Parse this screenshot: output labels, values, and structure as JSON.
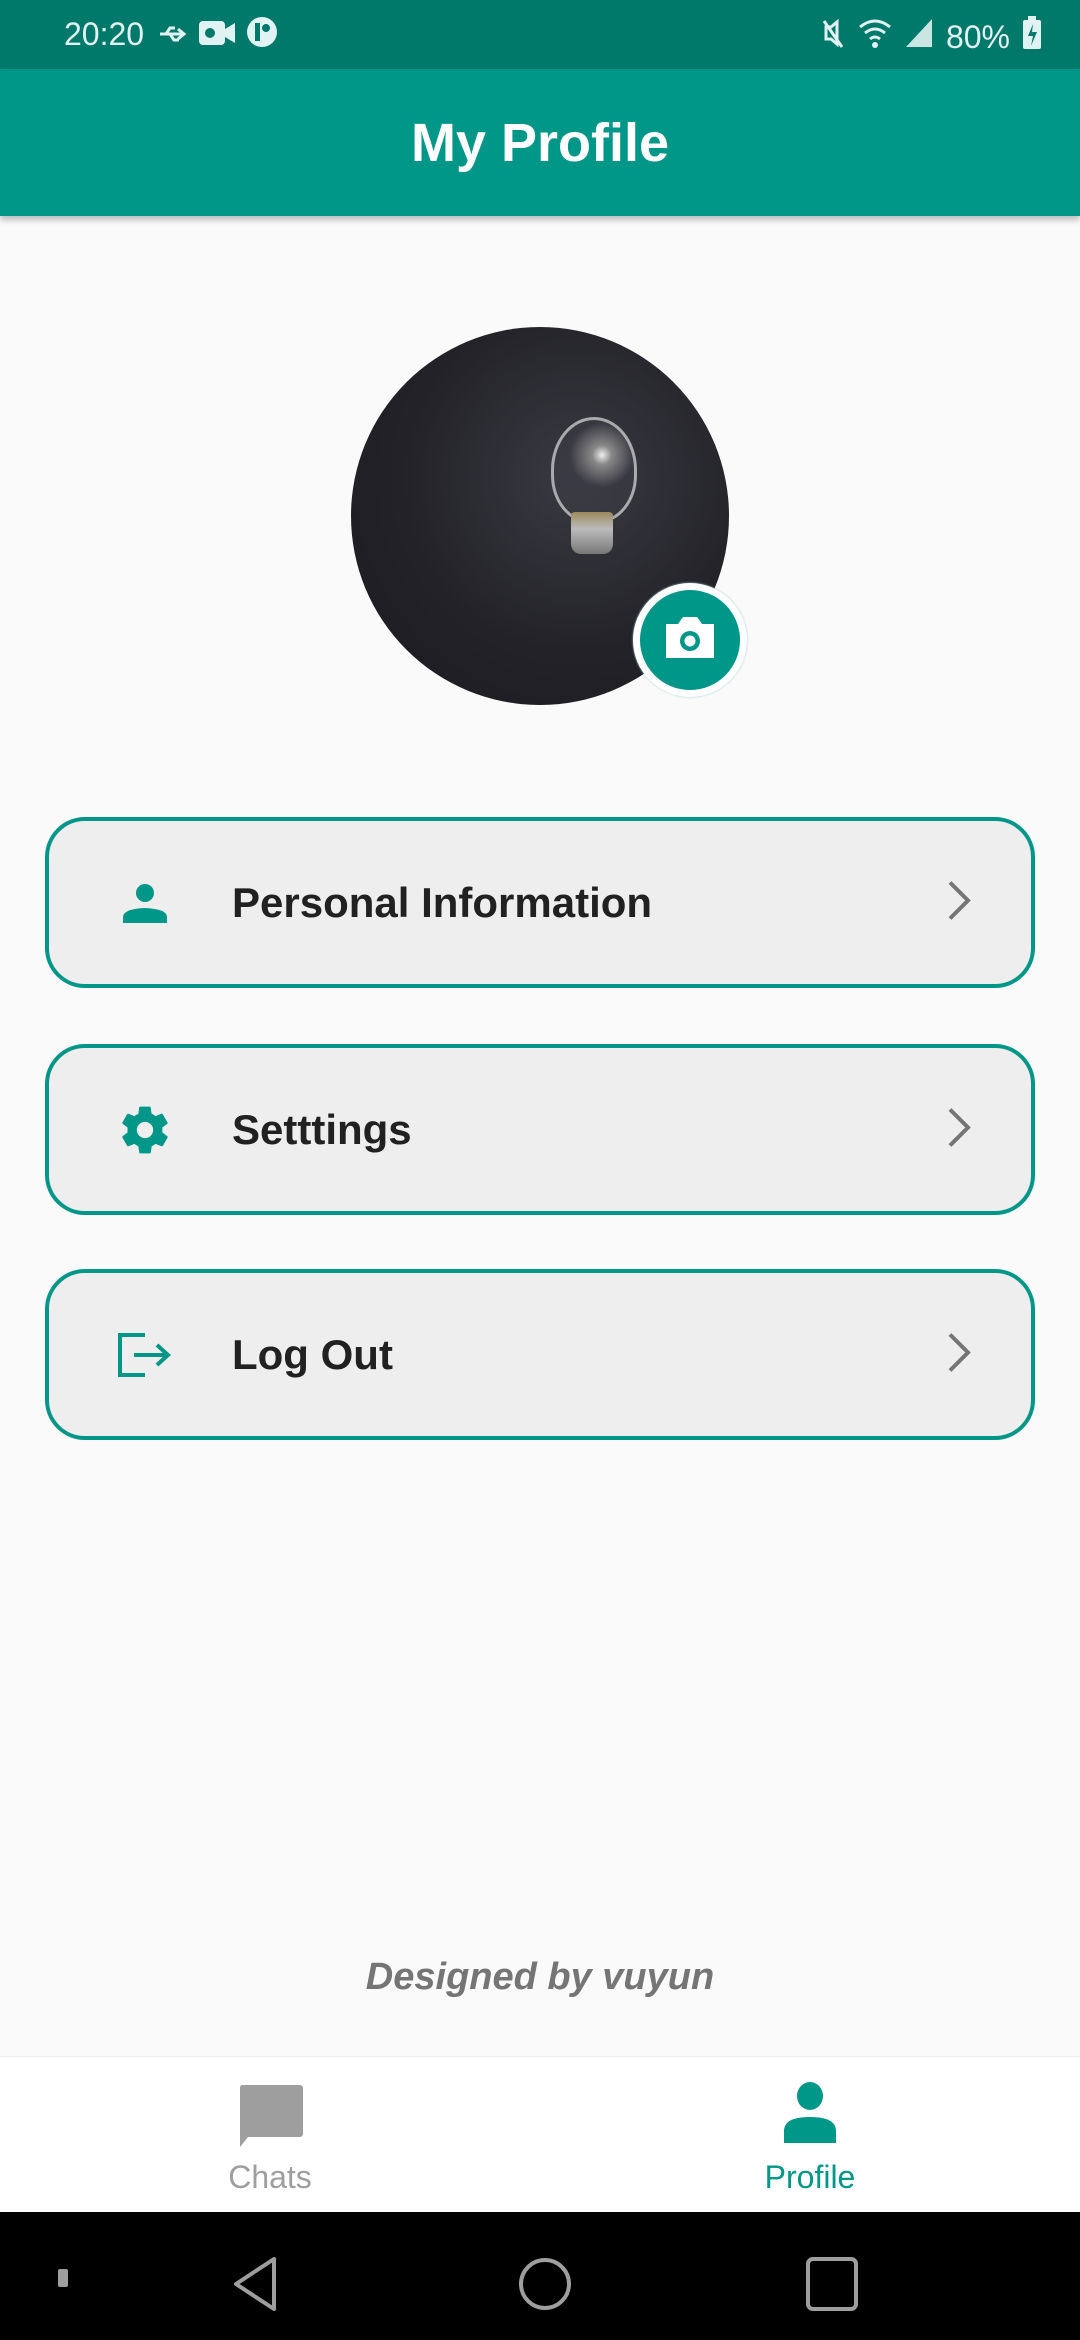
{
  "status_bar": {
    "time": "20:20",
    "battery": "80%",
    "icons": [
      "usb-icon",
      "video-camera-icon",
      "notification-app-icon",
      "mute-vibrate-icon",
      "wifi-icon",
      "signal-icon",
      "battery-charging-icon"
    ]
  },
  "app_bar": {
    "title": "My Profile"
  },
  "profile": {
    "avatar": "lightbulb-photo",
    "change_photo_icon": "camera-icon"
  },
  "menu": [
    {
      "label": "Personal Information",
      "icon": "person-icon"
    },
    {
      "label": "Setttings",
      "icon": "gear-icon"
    },
    {
      "label": "Log Out",
      "icon": "logout-icon"
    }
  ],
  "footer": {
    "credit": "Designed by vuyun"
  },
  "bottom_nav": {
    "items": [
      {
        "label": "Chats",
        "icon": "chat-bubble-icon",
        "active": false
      },
      {
        "label": "Profile",
        "icon": "person-icon",
        "active": true
      }
    ]
  },
  "colors": {
    "primary": "#009688",
    "primary_dark": "#00796b",
    "card_bg": "#eeeeee",
    "inactive": "#9e9e9e"
  }
}
